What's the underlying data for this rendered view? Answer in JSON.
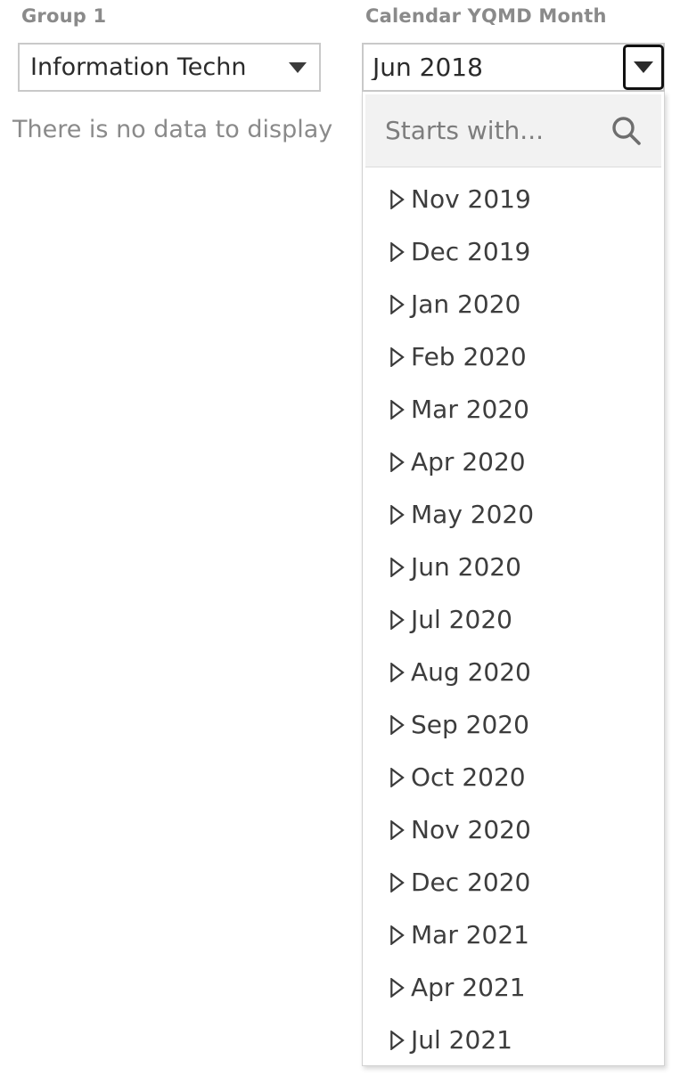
{
  "left_pane": {
    "label": "Group 1",
    "select": {
      "value": "Information Techn",
      "caret_icon": "caret-down-icon"
    },
    "empty_message": "There is no data to display"
  },
  "right_pane": {
    "label": "Calendar YQMD Month",
    "combobox": {
      "value": "Jun 2018",
      "toggle_icon": "caret-down-icon"
    },
    "dropdown": {
      "search": {
        "value": "",
        "placeholder": "Starts with...",
        "icon": "search-icon"
      },
      "item_icon": "triangle-right-outline-icon",
      "options": [
        {
          "label": "Nov 2019"
        },
        {
          "label": "Dec 2019"
        },
        {
          "label": "Jan 2020"
        },
        {
          "label": "Feb 2020"
        },
        {
          "label": "Mar 2020"
        },
        {
          "label": "Apr 2020"
        },
        {
          "label": "May 2020"
        },
        {
          "label": "Jun 2020"
        },
        {
          "label": "Jul 2020"
        },
        {
          "label": "Aug 2020"
        },
        {
          "label": "Sep 2020"
        },
        {
          "label": "Oct 2020"
        },
        {
          "label": "Nov 2020"
        },
        {
          "label": "Dec 2020"
        },
        {
          "label": "Mar 2021"
        },
        {
          "label": "Apr 2021"
        },
        {
          "label": "Jul 2021"
        }
      ]
    }
  },
  "colors": {
    "label_gray": "#8a8a8a",
    "text_dark": "#3d3d3d",
    "border_gray": "#c9c9c9",
    "search_bg": "#f2f2f2",
    "focus_border": "#111111"
  }
}
